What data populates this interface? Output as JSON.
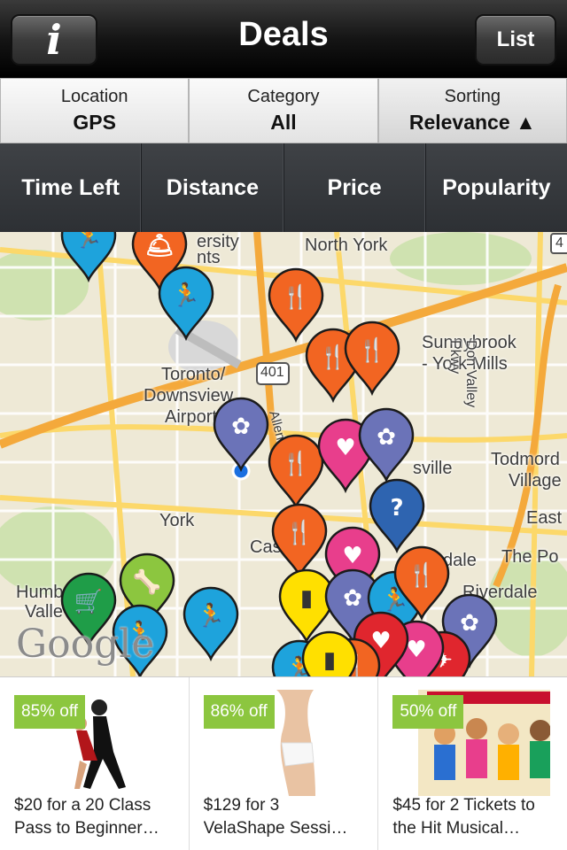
{
  "navbar": {
    "title": "Deals",
    "info_icon": "info-icon",
    "info_glyph": "i",
    "list_label": "List"
  },
  "filters": [
    {
      "label": "Location",
      "value": "GPS"
    },
    {
      "label": "Category",
      "value": "All"
    },
    {
      "label": "Sorting",
      "value": "Relevance ▲"
    }
  ],
  "sort_options": [
    "Time Left",
    "Distance",
    "Price",
    "Popularity"
  ],
  "map": {
    "labels": [
      "North York",
      "Sunnybrook",
      "- York Mills",
      "Toronto/",
      "Downsview",
      "Airport",
      "ersity",
      "nts",
      "York",
      "Cas",
      "sville",
      "Todmord",
      "Village",
      "East",
      "dale",
      "The Po",
      "Riverdale",
      "Humb",
      "Valle",
      "Don Valley Pkwy",
      "401",
      "Allen",
      "4"
    ],
    "watermark": "Google"
  },
  "deals": [
    {
      "discount": "85% off",
      "line1": "$20 for a 20 Class",
      "line2": "Pass to Beginner…"
    },
    {
      "discount": "86% off",
      "line1": "$129 for 3",
      "line2": "VelaShape Sessi…"
    },
    {
      "discount": "50% off",
      "line1": "$45 for 2 Tickets to",
      "line2": "the Hit Musical…"
    }
  ],
  "colors": {
    "accent_green": "#8cc63f",
    "pin_orange": "#f26522",
    "pin_blue": "#1ea3dc",
    "pin_purple": "#6b73b8",
    "pin_pink": "#e83e8c",
    "pin_yellow": "#ffe000",
    "pin_red": "#e0262e"
  }
}
